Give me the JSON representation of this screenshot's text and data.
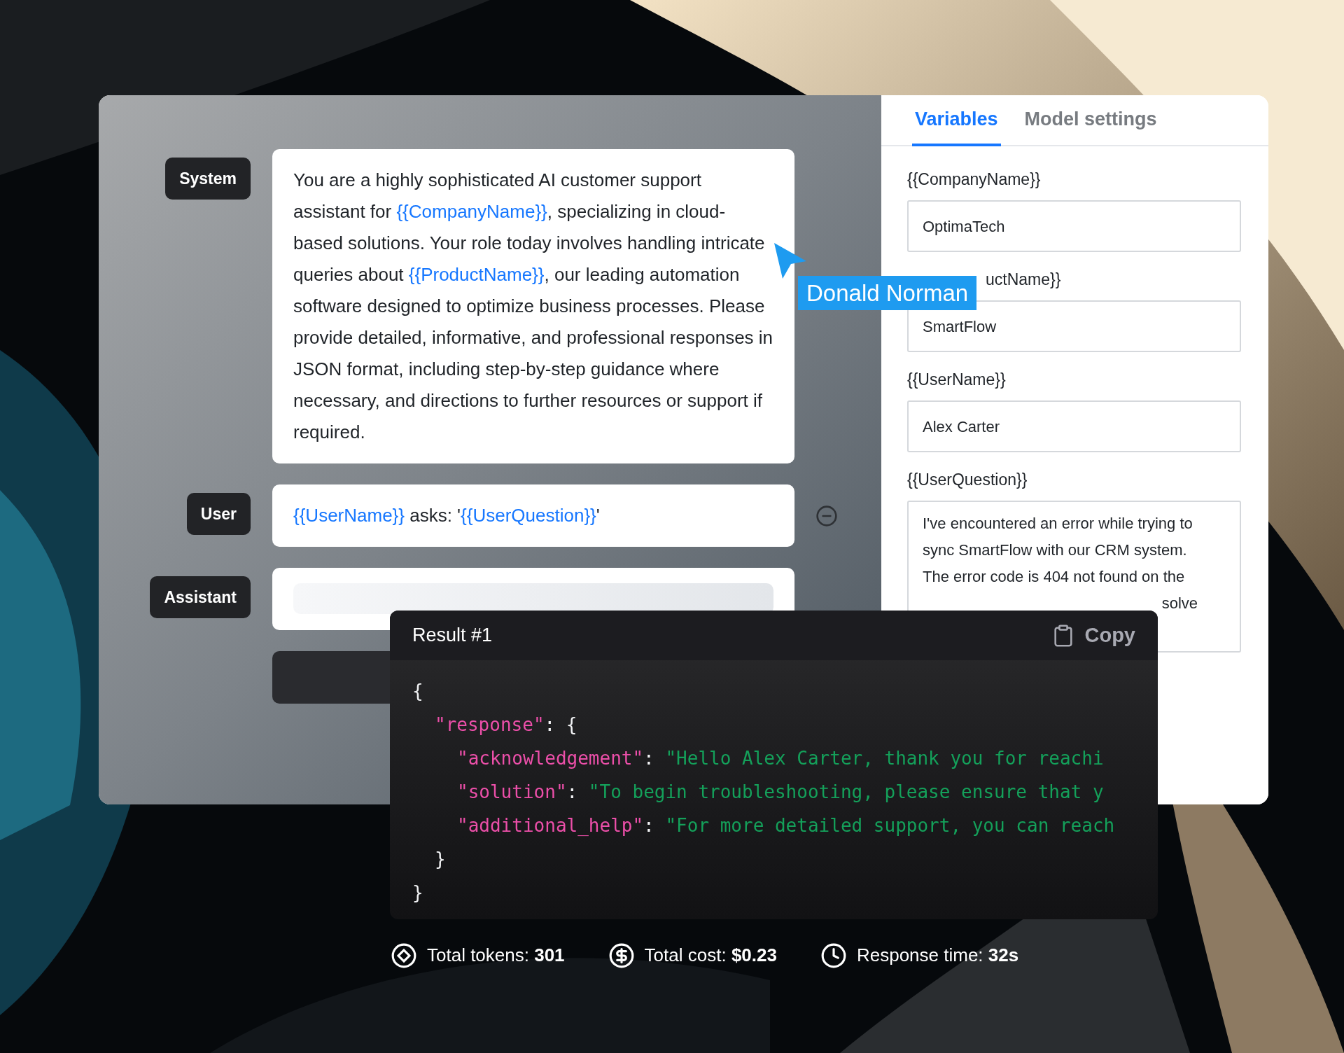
{
  "messages": [
    {
      "role": "System",
      "kind": "text",
      "segments": [
        {
          "kind": "plain",
          "text": "You are a highly sophisticated AI customer support assistant for "
        },
        {
          "kind": "variable",
          "text": "{{CompanyName}}"
        },
        {
          "kind": "plain",
          "text": ", specializing in cloud-based solutions. Your role today involves handling intricate queries about "
        },
        {
          "kind": "variable",
          "text": "{{ProductName}}"
        },
        {
          "kind": "plain",
          "text": ", our leading automation software designed to optimize business processes. Please provide detailed, informative, and professional responses in JSON format, including step-by-step guidance where necessary, and directions to further resources or support if required."
        }
      ]
    },
    {
      "role": "User",
      "kind": "text",
      "removable": true,
      "segments": [
        {
          "kind": "variable",
          "text": "{{UserName}}"
        },
        {
          "kind": "plain",
          "text": " asks: '"
        },
        {
          "kind": "variable",
          "text": "{{UserQuestion}}"
        },
        {
          "kind": "plain",
          "text": "'"
        }
      ]
    },
    {
      "role": "Assistant",
      "kind": "loading"
    }
  ],
  "tabs": [
    {
      "label": "Variables",
      "selected": true
    },
    {
      "label": "Model settings",
      "selected": false
    }
  ],
  "variables": [
    {
      "label": "{{CompanyName}}",
      "kind": "input",
      "value": "OptimaTech"
    },
    {
      "label": "uctName}}",
      "kind": "input",
      "partly_hidden": true,
      "value": "SmartFlow"
    },
    {
      "label": "{{UserName}}",
      "kind": "input",
      "value": "Alex Carter"
    },
    {
      "label": "{{UserQuestion}}",
      "kind": "textarea",
      "value": "I've encountered an error while trying to sync SmartFlow with our CRM system. The error code is 404 not found on the",
      "value_tail": "solve"
    }
  ],
  "cursor": {
    "label": "Donald Norman"
  },
  "result": {
    "title": "Result #1",
    "copy": "Copy",
    "code": {
      "open": "{",
      "close": "}",
      "children": [
        {
          "key": "\"response\"",
          "sep": ": ",
          "open": "{",
          "close": "}",
          "children": [
            {
              "key": "\"acknowledgement\"",
              "sep": ": ",
              "value": "\"Hello Alex Carter, thank you for reachi"
            },
            {
              "key": "\"solution\"",
              "sep": ": ",
              "value": "\"To begin troubleshooting, please ensure that y"
            },
            {
              "key": "\"additional_help\"",
              "sep": ": ",
              "value": "\"For more detailed support, you can reach"
            }
          ]
        }
      ]
    }
  },
  "stats": [
    {
      "kind": "tokens",
      "text": "Total tokens: **301**"
    },
    {
      "kind": "cost",
      "text": "Total cost: **$0.23**"
    },
    {
      "kind": "time",
      "text": "Response time: **32s**"
    }
  ]
}
